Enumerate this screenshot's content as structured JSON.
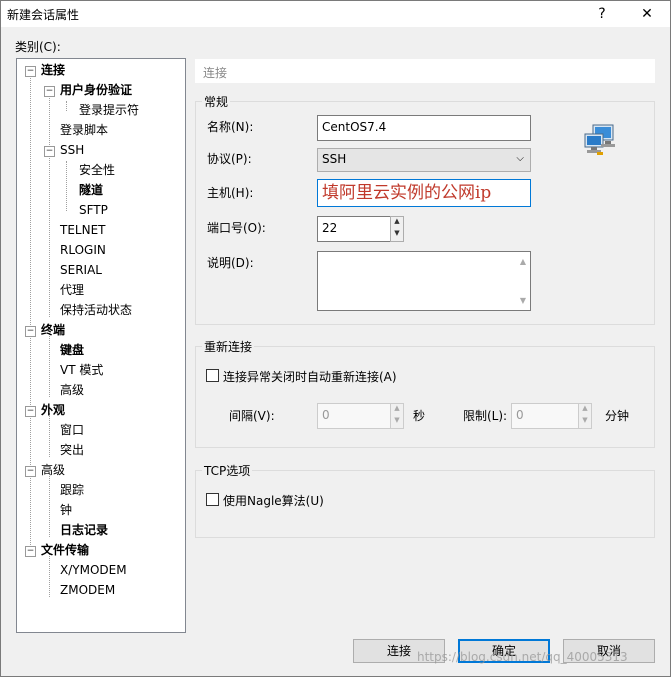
{
  "window": {
    "title": "新建会话属性",
    "help_glyph": "?",
    "close_glyph": "✕"
  },
  "category_label": "类别(C):",
  "tree": {
    "connection": "连接",
    "user_auth": "用户身份验证",
    "login_prompt": "登录提示符",
    "login_script": "登录脚本",
    "ssh": "SSH",
    "security": "安全性",
    "tunnel": "隧道",
    "sftp": "SFTP",
    "telnet": "TELNET",
    "rlogin": "RLOGIN",
    "serial": "SERIAL",
    "proxy": "代理",
    "keepalive": "保持活动状态",
    "terminal": "终端",
    "keyboard": "键盘",
    "vt_mode": "VT 模式",
    "advanced1": "高级",
    "appearance": "外观",
    "window": "窗口",
    "highlight": "突出",
    "advanced": "高级",
    "trace": "跟踪",
    "bell": "钟",
    "logging": "日志记录",
    "file_transfer": "文件传输",
    "xymodem": "X/YMODEM",
    "zmodem": "ZMODEM"
  },
  "header": "连接",
  "general": {
    "legend": "常规",
    "name_label": "名称(N):",
    "name_value": "CentOS7.4",
    "protocol_label": "协议(P):",
    "protocol_value": "SSH",
    "host_label": "主机(H):",
    "host_value": "填阿里云实例的公网ip",
    "port_label": "端口号(O):",
    "port_value": "22",
    "desc_label": "说明(D):",
    "desc_value": ""
  },
  "reconnect": {
    "legend": "重新连接",
    "checkbox_label": "连接异常关闭时自动重新连接(A)",
    "interval_label": "间隔(V):",
    "interval_value": "0",
    "sec_unit": "秒",
    "limit_label": "限制(L):",
    "limit_value": "0",
    "min_unit": "分钟"
  },
  "tcp": {
    "legend": "TCP选项",
    "nagle_label": "使用Nagle算法(U)"
  },
  "buttons": {
    "connect": "连接",
    "ok": "确定",
    "cancel": "取消"
  },
  "watermark": "https://blog.csdn.net/qq_40005313",
  "colors": {
    "host_text": "#c0392b",
    "accent": "#0078d7"
  }
}
